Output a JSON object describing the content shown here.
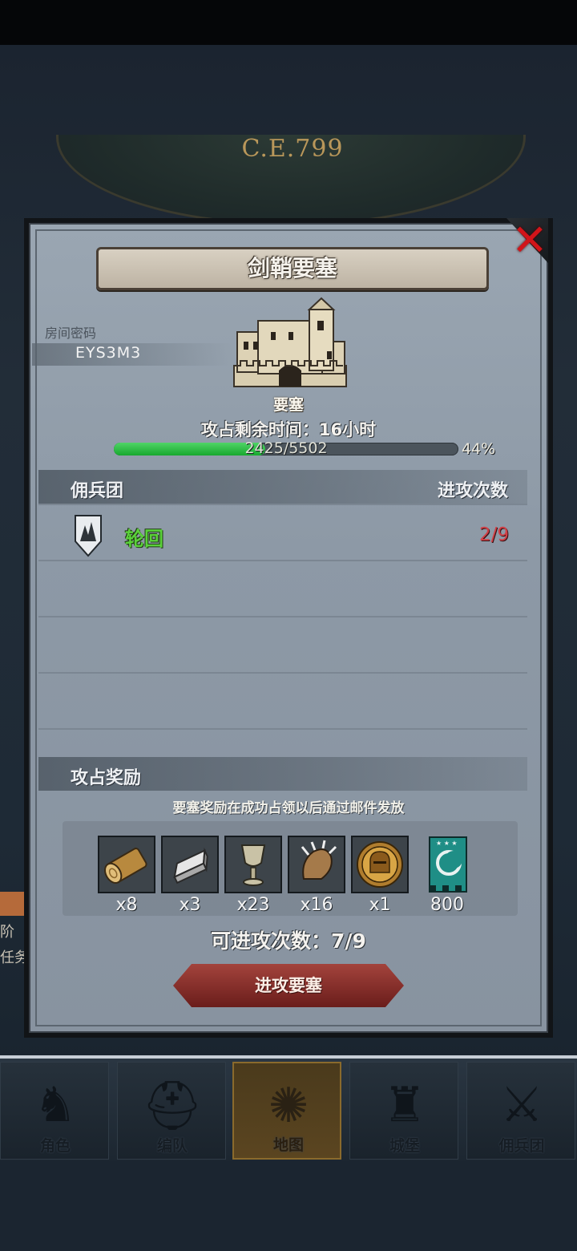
{
  "world": {
    "year": "C.E.799"
  },
  "modal": {
    "title": "剑鞘要塞",
    "room_label": "房间密码",
    "room_code": "EYS3M3",
    "building_name": "要塞",
    "time_remaining": "攻占剩余时间：16小时",
    "progress": {
      "text": "2425/5502",
      "current": 2425,
      "total": 5502,
      "percent_text": "44%",
      "fraction": 0.44
    },
    "guild_section": {
      "title": "佣兵团",
      "attacks_header": "进攻次数",
      "rows": [
        {
          "name": "轮回",
          "attacks": "2/9"
        }
      ]
    },
    "reward_section": {
      "title": "攻占奖励",
      "note": "要塞奖励在成功占领以后通过邮件发放",
      "items": [
        {
          "icon": "wood-log-icon",
          "count": "x8"
        },
        {
          "icon": "iron-ingot-icon",
          "count": "x3"
        },
        {
          "icon": "goblet-icon",
          "count": "x23"
        },
        {
          "icon": "claw-icon",
          "count": "x16"
        },
        {
          "icon": "helmet-medal-icon",
          "count": "x1"
        },
        {
          "icon": "banner-icon",
          "count": "800"
        }
      ]
    },
    "available_attacks": "可进攻次数：7/9",
    "attack_button": "进攻要塞"
  },
  "side_hints": {
    "line1": "阶",
    "line2": "任务"
  },
  "nav": {
    "tabs": [
      {
        "label": "角色",
        "icon": "knight-icon"
      },
      {
        "label": "编队",
        "icon": "helmet-icon"
      },
      {
        "label": "地图",
        "icon": "compass-icon",
        "active": true
      },
      {
        "label": "城堡",
        "icon": "castle-icon"
      },
      {
        "label": "佣兵团",
        "icon": "mercenary-icon"
      }
    ]
  },
  "colors": {
    "guild_name": "#5ad13a",
    "attack_count": "#d14046",
    "progress_fill": "#17a82e",
    "close_x": "#d2141a"
  }
}
